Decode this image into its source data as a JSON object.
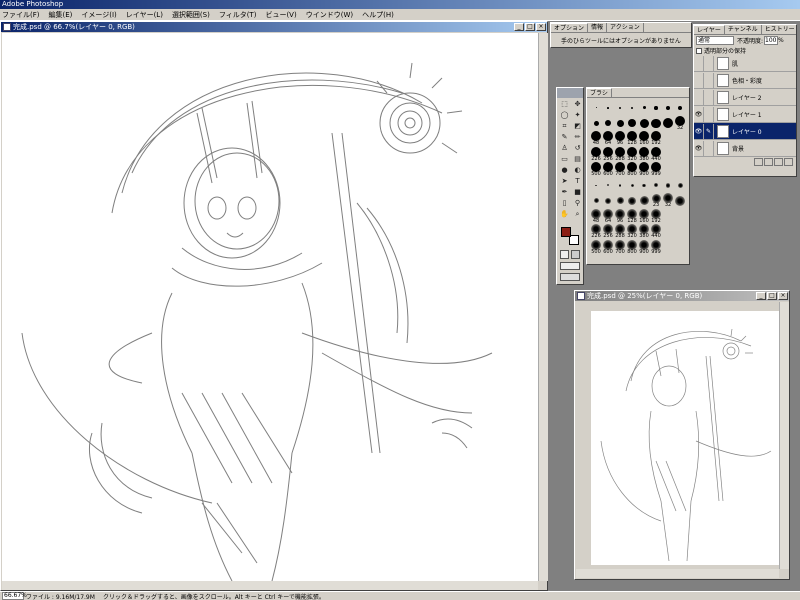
{
  "app": {
    "title": "Adobe Photoshop"
  },
  "menu": [
    "ファイル(F)",
    "編集(E)",
    "イメージ(I)",
    "レイヤー(L)",
    "選択範囲(S)",
    "フィルタ(T)",
    "ビュー(V)",
    "ウインドウ(W)",
    "ヘルプ(H)"
  ],
  "main_window": {
    "title": "完成.psd @ 66.7%(レイヤー 0, RGB)"
  },
  "nav_window": {
    "title": "完成.psd @ 25%(レイヤー 0, RGB)"
  },
  "options_palette": {
    "tabs": [
      "オプション",
      "情報",
      "アクション"
    ],
    "message": "手のひらツールにはオプションがありません"
  },
  "brush_palette": {
    "tab": "ブラシ",
    "rows": [
      [
        "",
        "",
        "",
        "",
        "",
        "",
        "",
        ""
      ],
      [
        "",
        "",
        "",
        "",
        "",
        "",
        "",
        "32"
      ],
      [
        "48",
        "64",
        "96",
        "128",
        "160",
        "192",
        "",
        ""
      ],
      [
        "226",
        "256",
        "288",
        "320",
        "380",
        "440",
        "",
        ""
      ],
      [
        "500",
        "600",
        "700",
        "800",
        "900",
        "999",
        "",
        ""
      ],
      [
        "",
        "",
        "",
        "",
        "",
        "",
        "",
        ""
      ],
      [
        "",
        "",
        "",
        "",
        "",
        "23",
        "32",
        ""
      ],
      [
        "48",
        "64",
        "96",
        "128",
        "160",
        "192",
        "",
        ""
      ],
      [
        "226",
        "256",
        "288",
        "320",
        "380",
        "440",
        "",
        ""
      ],
      [
        "500",
        "600",
        "700",
        "800",
        "900",
        "999",
        "",
        ""
      ]
    ]
  },
  "layers_palette": {
    "tabs": [
      "レイヤー",
      "チャンネル",
      "ヒストリー"
    ],
    "blend_mode": "通常",
    "opacity_label": "不透明度:",
    "opacity_value": "100",
    "opacity_unit": "%",
    "preserve_label": "透明部分の保持",
    "layers": [
      {
        "name": "肌",
        "visible": false,
        "selected": false
      },
      {
        "name": "色相・彩度",
        "visible": false,
        "selected": false
      },
      {
        "name": "レイヤー 2",
        "visible": false,
        "selected": false
      },
      {
        "name": "レイヤー 1",
        "visible": true,
        "selected": false
      },
      {
        "name": "レイヤー 0",
        "visible": true,
        "selected": true
      },
      {
        "name": "背景",
        "visible": true,
        "selected": false
      }
    ]
  },
  "toolbox": {
    "tools": [
      "marquee-icon",
      "move-icon",
      "lasso-icon",
      "magic-wand-icon",
      "crop-icon",
      "slice-icon",
      "brush-icon",
      "pencil-icon",
      "clone-stamp-icon",
      "history-brush-icon",
      "eraser-icon",
      "gradient-icon",
      "blur-icon",
      "dodge-icon",
      "path-select-icon",
      "type-icon",
      "pen-icon",
      "shape-icon",
      "notes-icon",
      "eyedropper-icon",
      "hand-icon",
      "zoom-icon"
    ],
    "foreground_color": "#8b1e14",
    "background_color": "#ffffff"
  },
  "status": {
    "zoom": "66.67%",
    "file_info": "ファイル : 9.16M/17.9M",
    "hint": "クリック＆ドラッグすると、画像をスクロール。Alt キーと Ctrl キーで機能拡張。"
  }
}
